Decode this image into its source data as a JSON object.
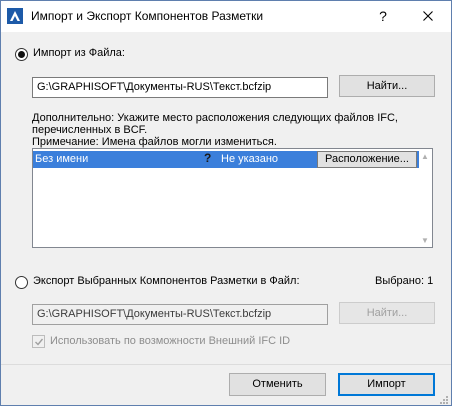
{
  "window": {
    "title": "Импорт и Экспорт Компонентов Разметки",
    "help_label": "?"
  },
  "import_section": {
    "radio_label": "Импорт из Файла:",
    "path_value": "G:\\GRAPHISOFT\\Документы-RUS\\Текст.bcfzip",
    "browse_label": "Найти...",
    "description_line1": "Дополнительно: Укажите место расположения следующих файлов IFC,",
    "description_line2": "перечисленных в BCF.",
    "description_line3": "Примечание: Имена файлов могли измениться.",
    "files": [
      {
        "name": "Без имени",
        "status_icon": "?",
        "status": "Не указано",
        "location_label": "Расположение..."
      }
    ]
  },
  "export_section": {
    "radio_label": "Экспорт Выбранных Компонентов Разметки в Файл:",
    "selected_count": "Выбрано: 1",
    "path_value": "G:\\GRAPHISOFT\\Документы-RUS\\Текст.bcfzip",
    "browse_label": "Найти...",
    "checkbox_label": "Использовать по возможности Внешний IFC ID",
    "checkbox_checked": true
  },
  "footer": {
    "cancel_label": "Отменить",
    "import_label": "Импорт"
  },
  "colors": {
    "selection": "#3b7fdb",
    "window_border": "#5f7fae",
    "primary_button_border": "#0078d7"
  }
}
